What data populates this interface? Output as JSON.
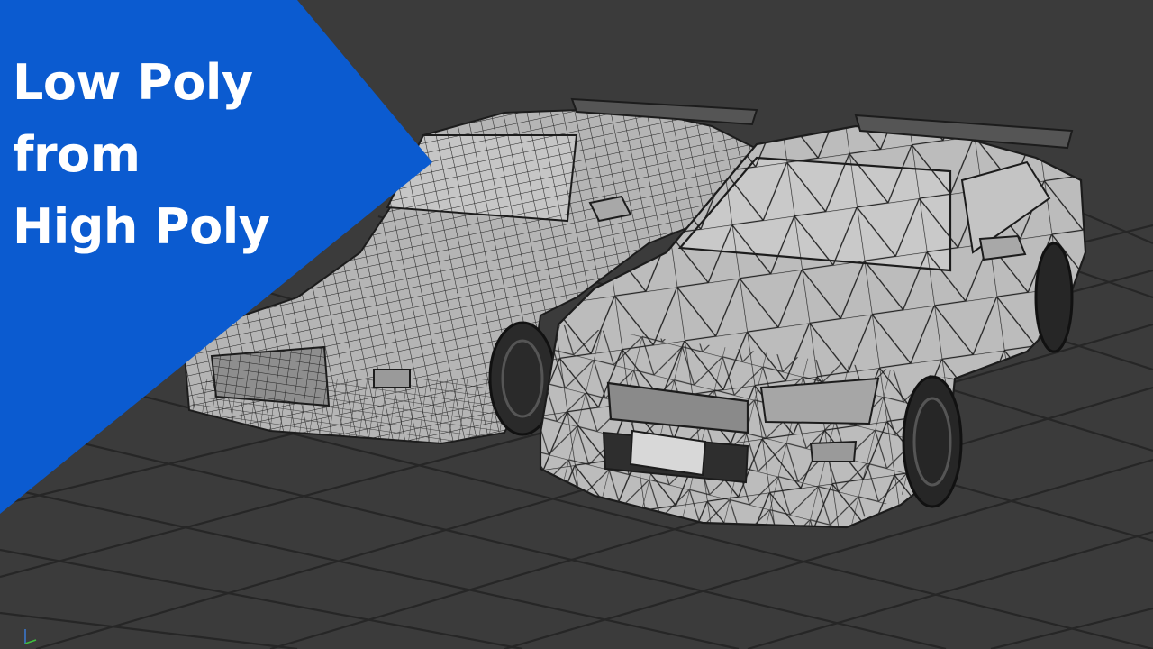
{
  "banner": {
    "lines": [
      "Low Poly",
      "from",
      "High Poly"
    ],
    "color": "#0b5bd0"
  },
  "scene": {
    "background_color": "#3b3b3b",
    "grid_color": "#262626",
    "model_color": "#b9b9b9",
    "wire_color": "#1c1c1c",
    "models": [
      {
        "name": "high-poly-car",
        "mesh": "dense quad wireframe"
      },
      {
        "name": "low-poly-car",
        "mesh": "sparse triangulated wireframe"
      }
    ]
  }
}
